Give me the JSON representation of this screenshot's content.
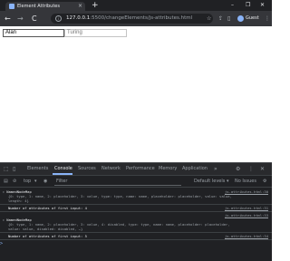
{
  "browser": {
    "tab_title": "Element Attributes",
    "tab_close_glyph": "×",
    "new_tab_glyph": "+",
    "window_controls": {
      "minimize": "–",
      "restore": "❐",
      "close": "✕"
    },
    "nav": {
      "back": "←",
      "forward": "→",
      "reload": "C"
    },
    "url_host": "127.0.0.1",
    "url_rest": ":5500/changeElements/js-attributes.html",
    "profile_label": "Guest",
    "toolbar_icons": {
      "share": "⇪",
      "star": "☆",
      "sidebar": "▯",
      "menu": "⋮"
    }
  },
  "page": {
    "inputs": [
      {
        "value": "Alan",
        "placeholder": ""
      },
      {
        "value": "",
        "placeholder": "Turing"
      }
    ]
  },
  "devtools": {
    "tabs": [
      "Elements",
      "Console",
      "Sources",
      "Network",
      "Performance",
      "Memory",
      "Application"
    ],
    "active_tab": "Console",
    "more_tabs": "»",
    "gear": "⚙",
    "more": "⋮",
    "close": "✕",
    "context": "top",
    "filter": "Filter",
    "levels": "Default levels ▾",
    "issues": "No Issues",
    "console_lines": [
      {
        "kind": "object",
        "head": "NamedNodeMap",
        "body": "{0: type, 1: name, 2: placeholder, 3: value, type: type, name: name, placeholder: placeholder, value: value, length: 4}",
        "source": "js-attributes.html:30"
      },
      {
        "kind": "log",
        "text": "Number of attributes of first input: 4",
        "source": "js-attributes.html:31"
      },
      {
        "kind": "object",
        "head": "NamedNodeMap",
        "body": "{0: type, 1: name, 2: placeholder, 3: value, 4: disabled, type: type, name: name, placeholder: placeholder, value: value, disabled: disabled, …}",
        "source": "js-attributes.html:33"
      },
      {
        "kind": "log",
        "text": "Number of attributes of first input: 5",
        "source": "js-attributes.html:34"
      }
    ],
    "prompt": ">"
  }
}
